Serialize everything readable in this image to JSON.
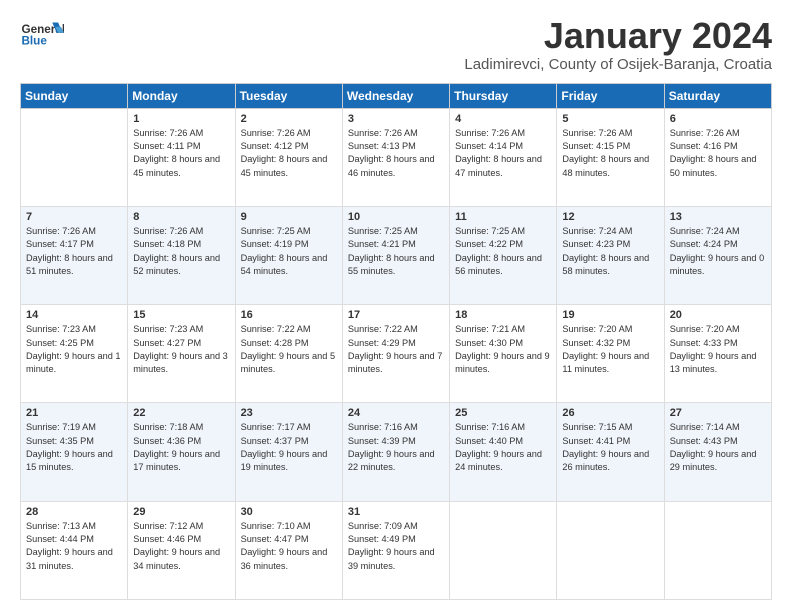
{
  "header": {
    "logo_general": "General",
    "logo_blue": "Blue",
    "month_title": "January 2024",
    "location": "Ladimirevci, County of Osijek-Baranja, Croatia"
  },
  "days_of_week": [
    "Sunday",
    "Monday",
    "Tuesday",
    "Wednesday",
    "Thursday",
    "Friday",
    "Saturday"
  ],
  "weeks": [
    [
      {
        "day": "",
        "sunrise": "",
        "sunset": "",
        "daylight": ""
      },
      {
        "day": "1",
        "sunrise": "Sunrise: 7:26 AM",
        "sunset": "Sunset: 4:11 PM",
        "daylight": "Daylight: 8 hours and 45 minutes."
      },
      {
        "day": "2",
        "sunrise": "Sunrise: 7:26 AM",
        "sunset": "Sunset: 4:12 PM",
        "daylight": "Daylight: 8 hours and 45 minutes."
      },
      {
        "day": "3",
        "sunrise": "Sunrise: 7:26 AM",
        "sunset": "Sunset: 4:13 PM",
        "daylight": "Daylight: 8 hours and 46 minutes."
      },
      {
        "day": "4",
        "sunrise": "Sunrise: 7:26 AM",
        "sunset": "Sunset: 4:14 PM",
        "daylight": "Daylight: 8 hours and 47 minutes."
      },
      {
        "day": "5",
        "sunrise": "Sunrise: 7:26 AM",
        "sunset": "Sunset: 4:15 PM",
        "daylight": "Daylight: 8 hours and 48 minutes."
      },
      {
        "day": "6",
        "sunrise": "Sunrise: 7:26 AM",
        "sunset": "Sunset: 4:16 PM",
        "daylight": "Daylight: 8 hours and 50 minutes."
      }
    ],
    [
      {
        "day": "7",
        "sunrise": "Sunrise: 7:26 AM",
        "sunset": "Sunset: 4:17 PM",
        "daylight": "Daylight: 8 hours and 51 minutes."
      },
      {
        "day": "8",
        "sunrise": "Sunrise: 7:26 AM",
        "sunset": "Sunset: 4:18 PM",
        "daylight": "Daylight: 8 hours and 52 minutes."
      },
      {
        "day": "9",
        "sunrise": "Sunrise: 7:25 AM",
        "sunset": "Sunset: 4:19 PM",
        "daylight": "Daylight: 8 hours and 54 minutes."
      },
      {
        "day": "10",
        "sunrise": "Sunrise: 7:25 AM",
        "sunset": "Sunset: 4:21 PM",
        "daylight": "Daylight: 8 hours and 55 minutes."
      },
      {
        "day": "11",
        "sunrise": "Sunrise: 7:25 AM",
        "sunset": "Sunset: 4:22 PM",
        "daylight": "Daylight: 8 hours and 56 minutes."
      },
      {
        "day": "12",
        "sunrise": "Sunrise: 7:24 AM",
        "sunset": "Sunset: 4:23 PM",
        "daylight": "Daylight: 8 hours and 58 minutes."
      },
      {
        "day": "13",
        "sunrise": "Sunrise: 7:24 AM",
        "sunset": "Sunset: 4:24 PM",
        "daylight": "Daylight: 9 hours and 0 minutes."
      }
    ],
    [
      {
        "day": "14",
        "sunrise": "Sunrise: 7:23 AM",
        "sunset": "Sunset: 4:25 PM",
        "daylight": "Daylight: 9 hours and 1 minute."
      },
      {
        "day": "15",
        "sunrise": "Sunrise: 7:23 AM",
        "sunset": "Sunset: 4:27 PM",
        "daylight": "Daylight: 9 hours and 3 minutes."
      },
      {
        "day": "16",
        "sunrise": "Sunrise: 7:22 AM",
        "sunset": "Sunset: 4:28 PM",
        "daylight": "Daylight: 9 hours and 5 minutes."
      },
      {
        "day": "17",
        "sunrise": "Sunrise: 7:22 AM",
        "sunset": "Sunset: 4:29 PM",
        "daylight": "Daylight: 9 hours and 7 minutes."
      },
      {
        "day": "18",
        "sunrise": "Sunrise: 7:21 AM",
        "sunset": "Sunset: 4:30 PM",
        "daylight": "Daylight: 9 hours and 9 minutes."
      },
      {
        "day": "19",
        "sunrise": "Sunrise: 7:20 AM",
        "sunset": "Sunset: 4:32 PM",
        "daylight": "Daylight: 9 hours and 11 minutes."
      },
      {
        "day": "20",
        "sunrise": "Sunrise: 7:20 AM",
        "sunset": "Sunset: 4:33 PM",
        "daylight": "Daylight: 9 hours and 13 minutes."
      }
    ],
    [
      {
        "day": "21",
        "sunrise": "Sunrise: 7:19 AM",
        "sunset": "Sunset: 4:35 PM",
        "daylight": "Daylight: 9 hours and 15 minutes."
      },
      {
        "day": "22",
        "sunrise": "Sunrise: 7:18 AM",
        "sunset": "Sunset: 4:36 PM",
        "daylight": "Daylight: 9 hours and 17 minutes."
      },
      {
        "day": "23",
        "sunrise": "Sunrise: 7:17 AM",
        "sunset": "Sunset: 4:37 PM",
        "daylight": "Daylight: 9 hours and 19 minutes."
      },
      {
        "day": "24",
        "sunrise": "Sunrise: 7:16 AM",
        "sunset": "Sunset: 4:39 PM",
        "daylight": "Daylight: 9 hours and 22 minutes."
      },
      {
        "day": "25",
        "sunrise": "Sunrise: 7:16 AM",
        "sunset": "Sunset: 4:40 PM",
        "daylight": "Daylight: 9 hours and 24 minutes."
      },
      {
        "day": "26",
        "sunrise": "Sunrise: 7:15 AM",
        "sunset": "Sunset: 4:41 PM",
        "daylight": "Daylight: 9 hours and 26 minutes."
      },
      {
        "day": "27",
        "sunrise": "Sunrise: 7:14 AM",
        "sunset": "Sunset: 4:43 PM",
        "daylight": "Daylight: 9 hours and 29 minutes."
      }
    ],
    [
      {
        "day": "28",
        "sunrise": "Sunrise: 7:13 AM",
        "sunset": "Sunset: 4:44 PM",
        "daylight": "Daylight: 9 hours and 31 minutes."
      },
      {
        "day": "29",
        "sunrise": "Sunrise: 7:12 AM",
        "sunset": "Sunset: 4:46 PM",
        "daylight": "Daylight: 9 hours and 34 minutes."
      },
      {
        "day": "30",
        "sunrise": "Sunrise: 7:10 AM",
        "sunset": "Sunset: 4:47 PM",
        "daylight": "Daylight: 9 hours and 36 minutes."
      },
      {
        "day": "31",
        "sunrise": "Sunrise: 7:09 AM",
        "sunset": "Sunset: 4:49 PM",
        "daylight": "Daylight: 9 hours and 39 minutes."
      },
      {
        "day": "",
        "sunrise": "",
        "sunset": "",
        "daylight": ""
      },
      {
        "day": "",
        "sunrise": "",
        "sunset": "",
        "daylight": ""
      },
      {
        "day": "",
        "sunrise": "",
        "sunset": "",
        "daylight": ""
      }
    ]
  ]
}
